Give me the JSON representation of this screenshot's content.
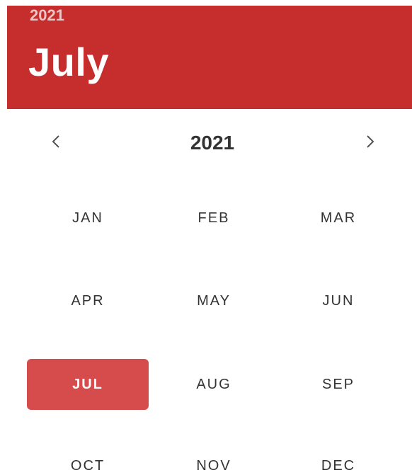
{
  "header": {
    "year": "2021",
    "month": "July"
  },
  "nav": {
    "prev_icon": "chevron-left-icon",
    "next_icon": "chevron-right-icon",
    "year": "2021"
  },
  "months": [
    {
      "label": "JAN",
      "selected": false
    },
    {
      "label": "FEB",
      "selected": false
    },
    {
      "label": "MAR",
      "selected": false
    },
    {
      "label": "APR",
      "selected": false
    },
    {
      "label": "MAY",
      "selected": false
    },
    {
      "label": "JUN",
      "selected": false
    },
    {
      "label": "JUL",
      "selected": true
    },
    {
      "label": "AUG",
      "selected": false
    },
    {
      "label": "SEP",
      "selected": false
    },
    {
      "label": "OCT",
      "selected": false
    },
    {
      "label": "NOV",
      "selected": false
    },
    {
      "label": "DEC",
      "selected": false
    }
  ],
  "colors": {
    "header_bg": "#c62d2d",
    "selected_bg": "#d64c4c"
  }
}
